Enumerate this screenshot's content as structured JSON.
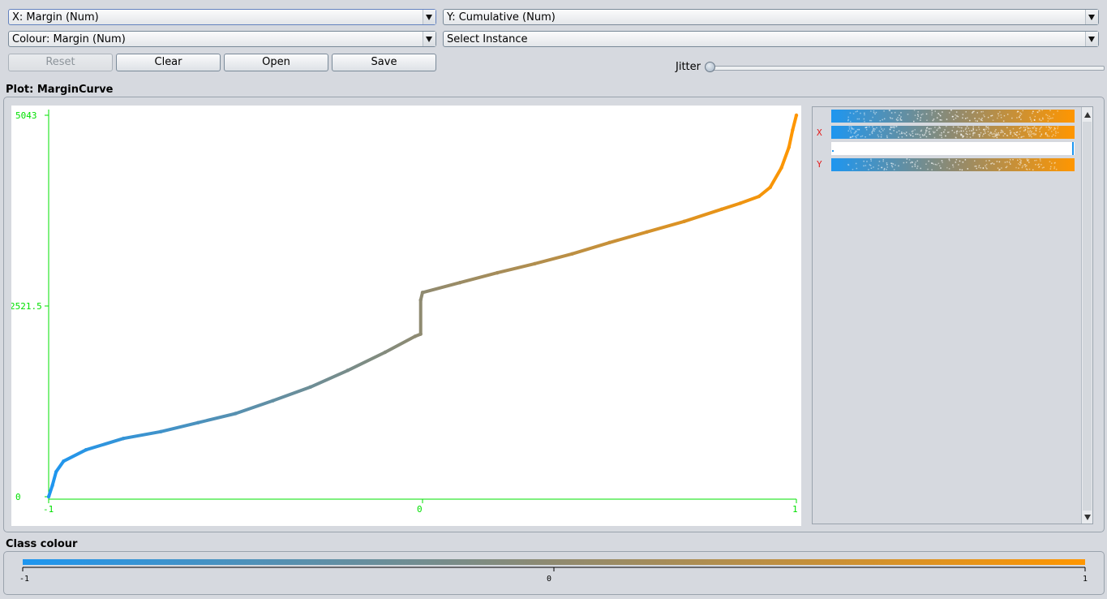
{
  "selectors": {
    "x_axis": "X: Margin (Num)",
    "y_axis": "Y: Cumulative (Num)",
    "colour": "Colour: Margin (Num)",
    "instance": "Select Instance"
  },
  "buttons": {
    "reset": "Reset",
    "clear": "Clear",
    "open": "Open",
    "save": "Save"
  },
  "jitter": {
    "label": "Jitter",
    "value": 0
  },
  "plot": {
    "title": "Plot: MarginCurve",
    "x_ticks": [
      "-1",
      "0",
      "1"
    ],
    "y_ticks": [
      "5043",
      "2521.5",
      "0"
    ]
  },
  "legend": {
    "x_label": "X",
    "y_label": "Y"
  },
  "class_colour": {
    "title": "Class colour",
    "ticks": [
      "-1",
      "0",
      "1"
    ]
  },
  "colors": {
    "low": "#1e96f0",
    "high": "#ff9600",
    "axis": "#00e000",
    "axis_letter": "#e31a1a"
  },
  "chart_data": {
    "type": "scatter",
    "title": "Plot: MarginCurve",
    "xlabel": "X: Margin (Num)",
    "ylabel": "Y: Cumulative (Num)",
    "xlim": [
      -1,
      1
    ],
    "ylim": [
      0,
      5043
    ],
    "color_by": "Margin",
    "x": [
      -1.0,
      -0.99,
      -0.98,
      -0.96,
      -0.9,
      -0.8,
      -0.7,
      -0.6,
      -0.5,
      -0.4,
      -0.3,
      -0.2,
      -0.1,
      -0.02,
      -0.005,
      -0.005,
      0.0,
      0.1,
      0.2,
      0.3,
      0.4,
      0.5,
      0.6,
      0.7,
      0.8,
      0.85,
      0.9,
      0.93,
      0.96,
      0.98,
      0.99,
      1.0
    ],
    "y": [
      0,
      150,
      330,
      470,
      620,
      770,
      860,
      980,
      1100,
      1270,
      1450,
      1670,
      1910,
      2120,
      2150,
      2600,
      2700,
      2830,
      2960,
      3080,
      3210,
      3360,
      3500,
      3640,
      3800,
      3880,
      3970,
      4090,
      4350,
      4620,
      4850,
      5043
    ]
  }
}
